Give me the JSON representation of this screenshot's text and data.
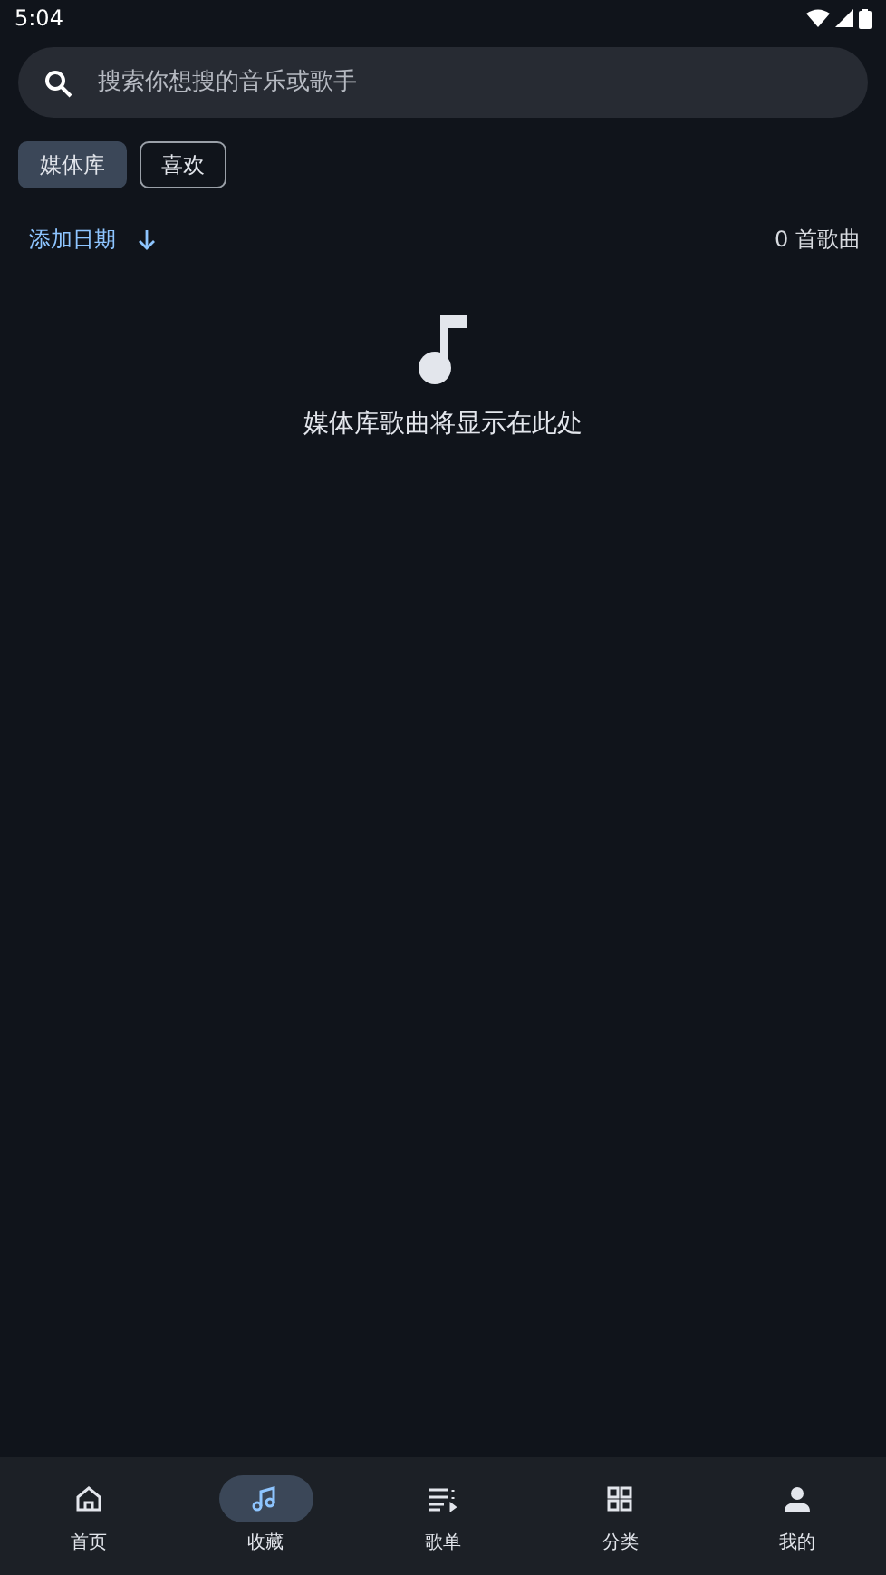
{
  "status_bar": {
    "time": "5:04"
  },
  "search": {
    "placeholder": "搜索你想搜的音乐或歌手"
  },
  "filters": [
    {
      "label": "媒体库",
      "selected": true
    },
    {
      "label": "喜欢",
      "selected": false
    }
  ],
  "sort": {
    "label": "添加日期",
    "count": "0 首歌曲"
  },
  "empty_state": {
    "message": "媒体库歌曲将显示在此处"
  },
  "nav": [
    {
      "label": "首页",
      "kind": "home",
      "selected": false
    },
    {
      "label": "收藏",
      "kind": "music",
      "selected": true
    },
    {
      "label": "歌单",
      "kind": "playlist",
      "selected": false
    },
    {
      "label": "分类",
      "kind": "grid",
      "selected": false
    },
    {
      "label": "我的",
      "kind": "person",
      "selected": false
    }
  ]
}
